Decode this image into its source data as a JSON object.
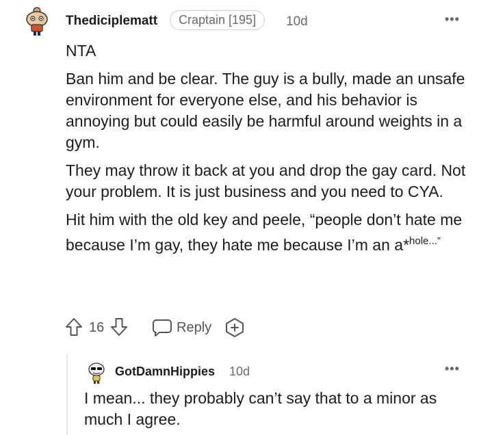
{
  "comment": {
    "username": "Thediciplematt",
    "flair": "Craptain [195]",
    "age": "10d",
    "more_menu": "•••",
    "title_line": "NTA",
    "paragraphs": [
      "Ban him and be clear. The guy is a bully, made an unsafe environment for everyone else, and his behavior is annoying but could easily be harmful around weights in a gym.",
      "They may throw it back at you and drop the gay card. Not your problem. It is just business and you need to CYA."
    ],
    "last_paragraph_main": "Hit him with the old key and peele, “people don’t hate me because I’m gay, they hate me because I’m an a*",
    "last_paragraph_sup": "hole...”",
    "vote_count": "16",
    "reply_label": "Reply"
  },
  "reply": {
    "username": "GotDamnHippies",
    "age": "10d",
    "more_menu": "•••",
    "text": "I mean... they probably can’t say that to a minor as much I agree."
  },
  "colors": {
    "text": "#1c1c1c",
    "muted": "#6a6a6a",
    "avatar_orange": "#d8502a"
  }
}
